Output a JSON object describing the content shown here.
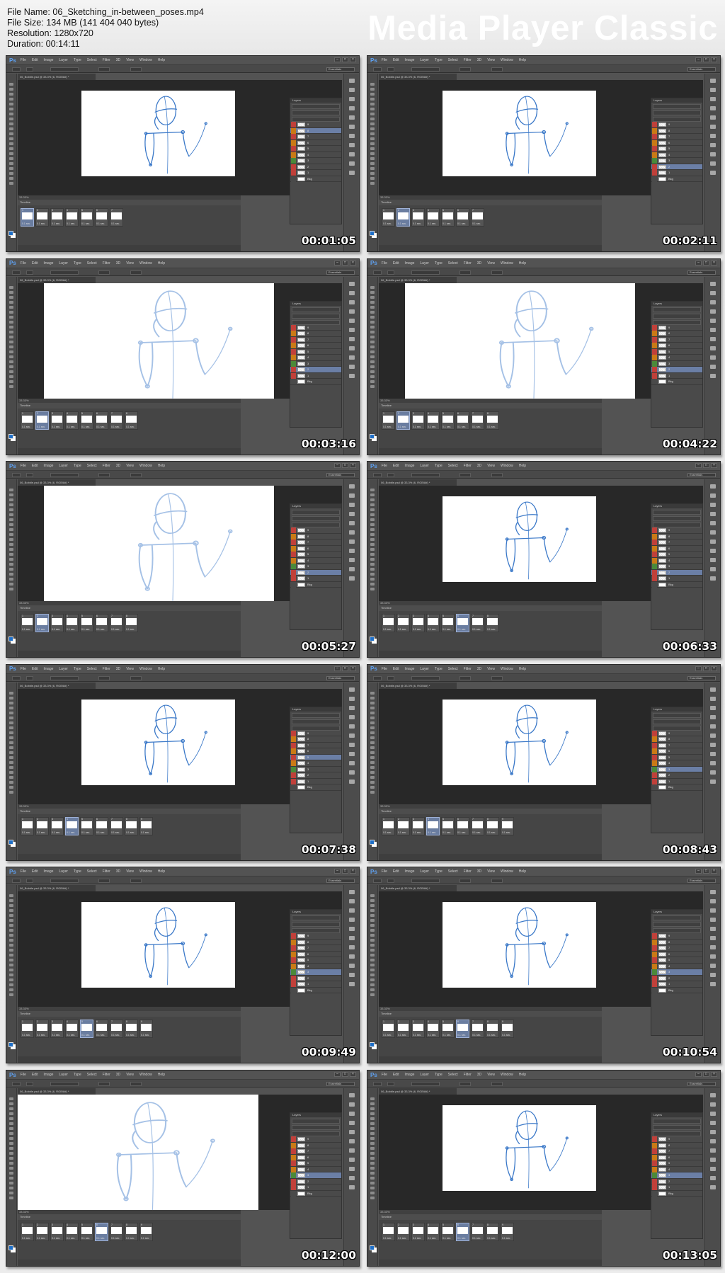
{
  "file_info": {
    "file_name": "File Name: 06_Sketching_in-between_poses.mp4",
    "file_size": "File Size: 134 MB (141 404 040 bytes)",
    "resolution": "Resolution: 1280x720",
    "duration": "Duration: 00:14:11"
  },
  "brand": "Media Player Classic",
  "app": {
    "logo": "Ps",
    "menu": [
      "File",
      "Edit",
      "Image",
      "Layer",
      "Type",
      "Select",
      "Filter",
      "3D",
      "View",
      "Window",
      "Help"
    ],
    "workspace": "Essentials",
    "doc_tab": "06_Bobble.psd @ 33.3% (6, RGB/8#) *",
    "timeline_title": "Timeline",
    "layers_title": "Layers",
    "frame_duration": "0.1 sec.",
    "window_buttons": [
      "–",
      "□",
      "×"
    ]
  },
  "thumbnails": [
    {
      "timestamp": "00:01:05",
      "zoom": "normal",
      "selected_frame": 1,
      "selected_layer": 1,
      "frames": 7
    },
    {
      "timestamp": "00:02:11",
      "zoom": "normal",
      "selected_frame": 2,
      "selected_layer": 7,
      "frames": 7
    },
    {
      "timestamp": "00:03:16",
      "zoom": "zoomed",
      "selected_frame": 2,
      "selected_layer": 7,
      "frames": 8
    },
    {
      "timestamp": "00:04:22",
      "zoom": "zoomed",
      "selected_frame": 2,
      "selected_layer": 7,
      "frames": 8
    },
    {
      "timestamp": "00:05:27",
      "zoom": "zoomed",
      "selected_frame": 2,
      "selected_layer": 7,
      "frames": 8
    },
    {
      "timestamp": "00:06:33",
      "zoom": "normal",
      "selected_frame": 6,
      "selected_layer": 7,
      "frames": 8
    },
    {
      "timestamp": "00:07:38",
      "zoom": "normal",
      "selected_frame": 4,
      "selected_layer": 4,
      "frames": 9
    },
    {
      "timestamp": "00:08:43",
      "zoom": "normal",
      "selected_frame": 4,
      "selected_layer": 6,
      "frames": 9
    },
    {
      "timestamp": "00:09:49",
      "zoom": "normal",
      "selected_frame": 5,
      "selected_layer": 6,
      "frames": 9
    },
    {
      "timestamp": "00:10:54",
      "zoom": "normal",
      "selected_frame": 6,
      "selected_layer": 6,
      "frames": 9
    },
    {
      "timestamp": "00:12:00",
      "zoom": "zoomed-close",
      "selected_frame": 6,
      "selected_layer": 6,
      "frames": 9
    },
    {
      "timestamp": "00:13:05",
      "zoom": "normal",
      "selected_frame": 6,
      "selected_layer": 6,
      "frames": 9
    }
  ],
  "layers": [
    "9",
    "8",
    "7",
    "6",
    "5",
    "4",
    "3",
    "2",
    "1",
    "Bkg"
  ],
  "colors": {
    "stroke": "#3a78c8",
    "tag_red": "#c0403a",
    "tag_orange": "#c97a16",
    "tag_green": "#4a8a3a",
    "selection": "#6b7fa6"
  }
}
